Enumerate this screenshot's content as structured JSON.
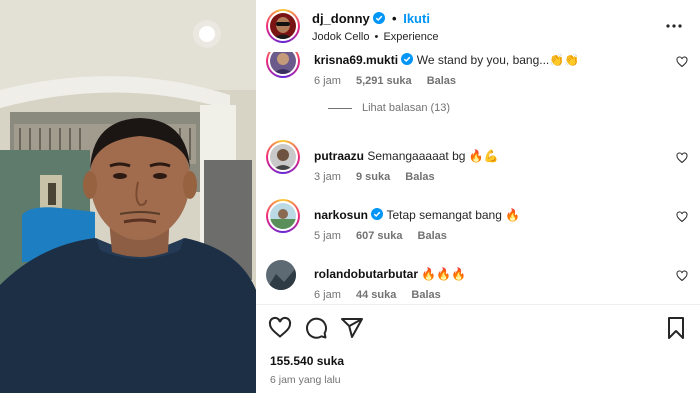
{
  "post": {
    "username": "dj_donny",
    "follow_label": "Ikuti",
    "separator": "•",
    "subtitle_name": "Jodok Cello",
    "subtitle_sep": "•",
    "subtitle_tag": "Experience",
    "likes": "155.540 suka",
    "posted": "6 jam yang lalu"
  },
  "comments": [
    {
      "username": "krisna69.mukti",
      "verified": true,
      "text": "We stand by you, bang...👏👏",
      "time": "6 jam",
      "likes": "5,291 suka",
      "reply": "Balas"
    },
    {
      "username": "putraazu",
      "verified": false,
      "text": "Semangaaaaat bg 🔥💪",
      "time": "3 jam",
      "likes": "9 suka",
      "reply": "Balas"
    },
    {
      "username": "narkosun",
      "verified": true,
      "text": "Tetap semangat bang 🔥",
      "time": "5 jam",
      "likes": "607 suka",
      "reply": "Balas"
    },
    {
      "username": "rolandobutarbutar",
      "verified": false,
      "text": "🔥🔥🔥",
      "time": "6 jam",
      "likes": "44 suka",
      "reply": "Balas"
    }
  ],
  "replies_label": "Lihat balasan (13)",
  "icons": {
    "more": "more-horizontal-icon",
    "verified": "verified-badge-icon",
    "like": "heart-icon",
    "comment": "comment-icon",
    "share": "share-icon",
    "save": "bookmark-icon"
  },
  "colors": {
    "accent": "#0095f6",
    "secondary_text": "#737373"
  }
}
